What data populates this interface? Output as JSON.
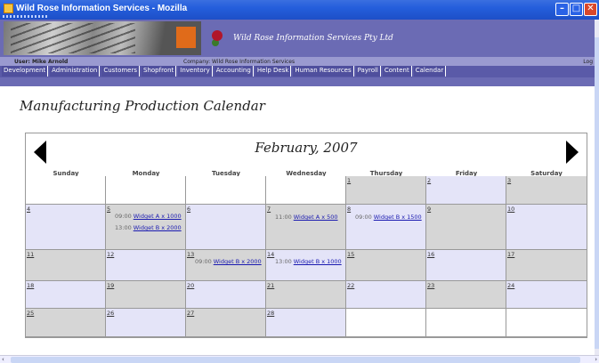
{
  "window": {
    "title": "Wild Rose Information Services - Mozilla"
  },
  "header": {
    "company_name": "Wild Rose Information Services Pty Ltd",
    "user_text": "User: Mike Arnold",
    "company_text": "Company: Wild Rose Information Services",
    "logout_text": "Log"
  },
  "nav": {
    "items": [
      "Development",
      "Administration",
      "Customers",
      "Shopfront",
      "Inventory",
      "Accounting",
      "Help Desk",
      "Human Resources",
      "Payroll",
      "Content",
      "Calendar"
    ]
  },
  "page": {
    "title": "Manufacturing Production Calendar"
  },
  "calendar": {
    "month_label": "February, 2007",
    "days_of_week": [
      "Sunday",
      "Monday",
      "Tuesday",
      "Wednesday",
      "Thursday",
      "Friday",
      "Saturday"
    ],
    "weeks": [
      [
        {
          "day": "",
          "shade": "white",
          "events": []
        },
        {
          "day": "",
          "shade": "white",
          "events": []
        },
        {
          "day": "",
          "shade": "white",
          "events": []
        },
        {
          "day": "",
          "shade": "white",
          "events": []
        },
        {
          "day": "1",
          "shade": "gray",
          "events": []
        },
        {
          "day": "2",
          "shade": "blue",
          "events": []
        },
        {
          "day": "3",
          "shade": "gray",
          "events": []
        }
      ],
      [
        {
          "day": "4",
          "shade": "blue",
          "events": []
        },
        {
          "day": "5",
          "shade": "gray",
          "events": [
            {
              "time": "09:00",
              "item": "Widget A x 1000"
            },
            {
              "time": "13:00",
              "item": "Widget B x 2000"
            }
          ]
        },
        {
          "day": "6",
          "shade": "blue",
          "events": []
        },
        {
          "day": "7",
          "shade": "gray",
          "events": [
            {
              "time": "11:00",
              "item": "Widget A x 500"
            }
          ]
        },
        {
          "day": "8",
          "shade": "blue",
          "events": [
            {
              "time": "09:00",
              "item": "Widget B x 1500"
            }
          ]
        },
        {
          "day": "9",
          "shade": "gray",
          "events": []
        },
        {
          "day": "10",
          "shade": "blue",
          "events": []
        }
      ],
      [
        {
          "day": "11",
          "shade": "gray",
          "events": []
        },
        {
          "day": "12",
          "shade": "blue",
          "events": []
        },
        {
          "day": "13",
          "shade": "gray",
          "events": [
            {
              "time": "09:00",
              "item": "Widget B x 2000"
            }
          ]
        },
        {
          "day": "14",
          "shade": "blue",
          "events": [
            {
              "time": "13:00",
              "item": "Widget B x 1000"
            }
          ]
        },
        {
          "day": "15",
          "shade": "gray",
          "events": []
        },
        {
          "day": "16",
          "shade": "blue",
          "events": []
        },
        {
          "day": "17",
          "shade": "gray",
          "events": []
        }
      ],
      [
        {
          "day": "18",
          "shade": "blue",
          "events": []
        },
        {
          "day": "19",
          "shade": "gray",
          "events": []
        },
        {
          "day": "20",
          "shade": "blue",
          "events": []
        },
        {
          "day": "21",
          "shade": "gray",
          "events": []
        },
        {
          "day": "22",
          "shade": "blue",
          "events": []
        },
        {
          "day": "23",
          "shade": "gray",
          "events": []
        },
        {
          "day": "24",
          "shade": "blue",
          "events": []
        }
      ],
      [
        {
          "day": "25",
          "shade": "gray",
          "events": []
        },
        {
          "day": "26",
          "shade": "blue",
          "events": []
        },
        {
          "day": "27",
          "shade": "gray",
          "events": []
        },
        {
          "day": "28",
          "shade": "blue",
          "events": []
        },
        {
          "day": "",
          "shade": "white",
          "events": []
        },
        {
          "day": "",
          "shade": "white",
          "events": []
        },
        {
          "day": "",
          "shade": "white",
          "events": []
        }
      ]
    ]
  },
  "icons": {
    "prev": "triangle-left-icon",
    "next": "triangle-right-icon",
    "minimize": "minimize-icon",
    "maximize": "maximize-icon",
    "close": "close-icon"
  },
  "window_buttons": {
    "minimize": "–",
    "maximize": "□",
    "close": "✕"
  },
  "scroll_arrows": {
    "left": "‹",
    "right": "›"
  },
  "colors": {
    "header_purple": "#6b6bb4",
    "nav_purple": "#5a5aa8",
    "cell_gray": "#d6d6d6",
    "cell_blue": "#e4e4f8",
    "link_blue": "#1a1ab0"
  }
}
